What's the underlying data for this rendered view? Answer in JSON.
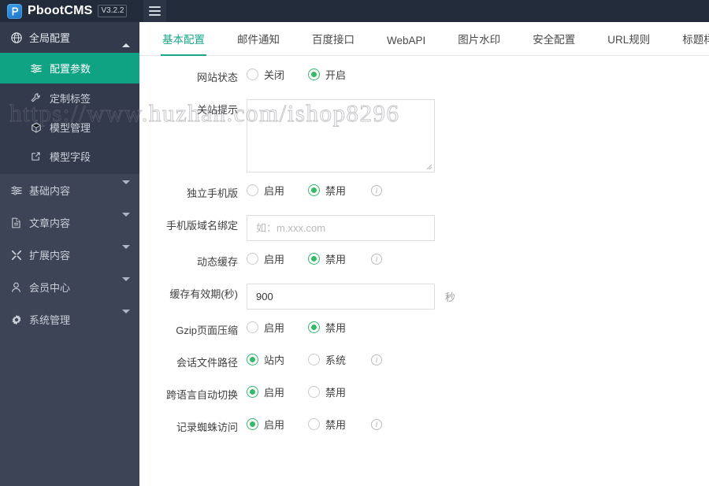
{
  "topbar": {
    "logo_icon": "pbootcms-logo-icon",
    "brand": "PbootCMS",
    "version": "V3.2.2",
    "menu_toggle_icon": "hamburger-menu-icon"
  },
  "sidebar": {
    "group": {
      "icon": "globe-icon",
      "label": "全局配置",
      "arrow_icon": "chevron-up-icon",
      "children": [
        {
          "icon": "sliders-icon",
          "label": "配置参数",
          "active": true
        },
        {
          "icon": "wrench-icon",
          "label": "定制标签",
          "active": false
        },
        {
          "icon": "cube-icon",
          "label": "模型管理",
          "active": false
        },
        {
          "icon": "external-link-icon",
          "label": "模型字段",
          "active": false
        }
      ]
    },
    "items": [
      {
        "icon": "sliders-icon",
        "label": "基础内容",
        "arrow_icon": "chevron-down-icon"
      },
      {
        "icon": "file-icon",
        "label": "文章内容",
        "arrow_icon": "chevron-down-icon"
      },
      {
        "icon": "expand-icon",
        "label": "扩展内容",
        "arrow_icon": "chevron-down-icon"
      },
      {
        "icon": "user-icon",
        "label": "会员中心",
        "arrow_icon": "chevron-down-icon"
      },
      {
        "icon": "gear-icon",
        "label": "系统管理",
        "arrow_icon": "chevron-down-icon"
      }
    ]
  },
  "tabs": [
    {
      "label": "基本配置",
      "active": true
    },
    {
      "label": "邮件通知",
      "active": false
    },
    {
      "label": "百度接口",
      "active": false
    },
    {
      "label": "WebAPI",
      "active": false
    },
    {
      "label": "图片水印",
      "active": false
    },
    {
      "label": "安全配置",
      "active": false
    },
    {
      "label": "URL规则",
      "active": false
    },
    {
      "label": "标题样式",
      "active": false
    }
  ],
  "form": {
    "site_status": {
      "label": "网站状态",
      "options": [
        {
          "label": "关闭",
          "selected": false
        },
        {
          "label": "开启",
          "selected": true
        }
      ]
    },
    "close_tip": {
      "label": "关站提示",
      "value": "",
      "placeholder": ""
    },
    "mobile_standalone": {
      "label": "独立手机版",
      "options": [
        {
          "label": "启用",
          "selected": false
        },
        {
          "label": "禁用",
          "selected": true
        }
      ],
      "has_info": true
    },
    "mobile_domain": {
      "label": "手机版域名绑定",
      "value": "",
      "placeholder": "如：m.xxx.com"
    },
    "dynamic_cache": {
      "label": "动态缓存",
      "options": [
        {
          "label": "启用",
          "selected": false
        },
        {
          "label": "禁用",
          "selected": true
        }
      ],
      "has_info": true
    },
    "cache_ttl": {
      "label": "缓存有效期(秒)",
      "value": "900",
      "suffix": "秒"
    },
    "gzip": {
      "label": "Gzip页面压缩",
      "options": [
        {
          "label": "启用",
          "selected": false
        },
        {
          "label": "禁用",
          "selected": true
        }
      ],
      "has_info": false
    },
    "session_path": {
      "label": "会话文件路径",
      "options": [
        {
          "label": "站内",
          "selected": true
        },
        {
          "label": "系统",
          "selected": false
        }
      ],
      "has_info": true
    },
    "lang_auto_switch": {
      "label": "跨语言自动切换",
      "options": [
        {
          "label": "启用",
          "selected": true
        },
        {
          "label": "禁用",
          "selected": false
        }
      ],
      "has_info": false
    },
    "spider_log": {
      "label": "记录蜘蛛访问",
      "options": [
        {
          "label": "启用",
          "selected": true
        },
        {
          "label": "禁用",
          "selected": false
        }
      ],
      "has_info": true
    }
  },
  "watermark": {
    "text": "https://www.huzhan.com/ishop8296"
  },
  "colors": {
    "topbar_bg": "#222b39",
    "sidebar_bg": "#3d4455",
    "sidebar_group_bg": "#323a4b",
    "accent": "#0fa283",
    "tab_accent": "#18a689",
    "radio_on": "#35b96a",
    "logo_blue": "#2f8fd8"
  }
}
